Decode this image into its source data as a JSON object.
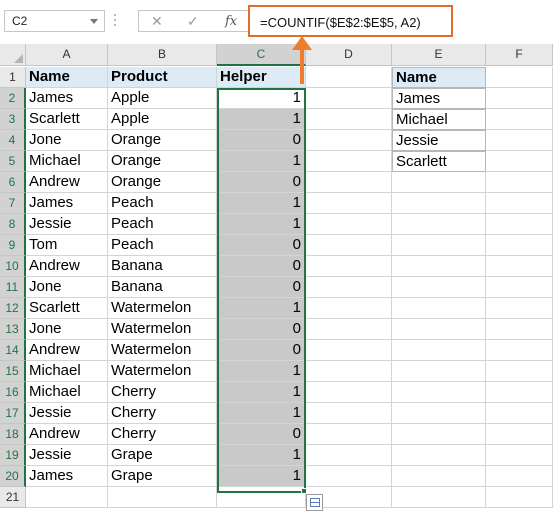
{
  "name_box": "C2",
  "formula_bar": {
    "cancel_glyph": "✕",
    "enter_glyph": "✓",
    "fx_glyph": "fx",
    "formula": "=COUNTIF($E$2:$E$5, A2)"
  },
  "columns": [
    "A",
    "B",
    "C",
    "D",
    "E",
    "F"
  ],
  "rows": [
    "1",
    "2",
    "3",
    "4",
    "5",
    "6",
    "7",
    "8",
    "9",
    "10",
    "11",
    "12",
    "13",
    "14",
    "15",
    "16",
    "17",
    "18",
    "19",
    "20",
    "21"
  ],
  "table": {
    "headers": [
      "Name",
      "Product",
      "Helper"
    ],
    "rows": [
      [
        "James",
        "Apple",
        "1"
      ],
      [
        "Scarlett",
        "Apple",
        "1"
      ],
      [
        "Jone",
        "Orange",
        "0"
      ],
      [
        "Michael",
        "Orange",
        "1"
      ],
      [
        "Andrew",
        "Orange",
        "0"
      ],
      [
        "James",
        "Peach",
        "1"
      ],
      [
        "Jessie",
        "Peach",
        "1"
      ],
      [
        "Tom",
        "Peach",
        "0"
      ],
      [
        "Andrew",
        "Banana",
        "0"
      ],
      [
        "Jone",
        "Banana",
        "0"
      ],
      [
        "Scarlett",
        "Watermelon",
        "1"
      ],
      [
        "Jone",
        "Watermelon",
        "0"
      ],
      [
        "Andrew",
        "Watermelon",
        "0"
      ],
      [
        "Michael",
        "Watermelon",
        "1"
      ],
      [
        "Michael",
        "Cherry",
        "1"
      ],
      [
        "Jessie",
        "Cherry",
        "1"
      ],
      [
        "Andrew",
        "Cherry",
        "0"
      ],
      [
        "Jessie",
        "Grape",
        "1"
      ],
      [
        "James",
        "Grape",
        "1"
      ]
    ]
  },
  "lookup": {
    "header": "Name",
    "values": [
      "James",
      "Michael",
      "Jessie",
      "Scarlett"
    ]
  },
  "colors": {
    "header_fill": "#ddebf7",
    "helper_fill": "#c9c9c9",
    "selection": "#217346",
    "arrow": "#ee7d30"
  },
  "icons": {
    "name_box_dropdown": "chevron-down-icon",
    "quick_analysis": "quick-analysis-icon"
  }
}
